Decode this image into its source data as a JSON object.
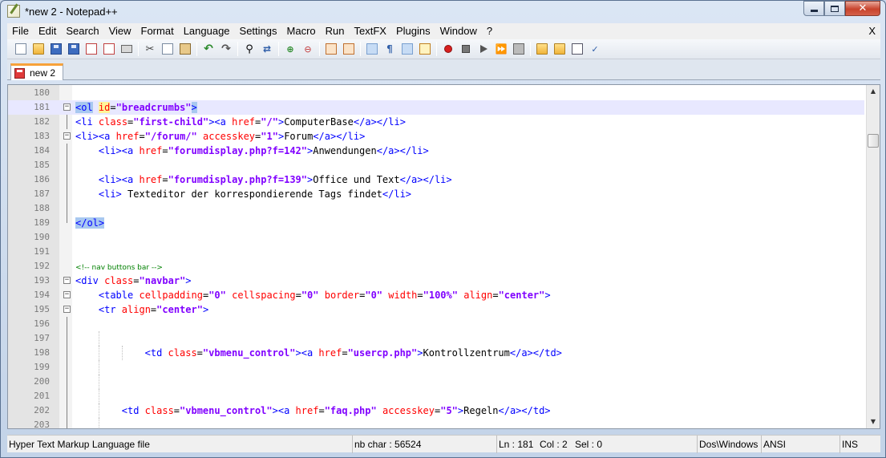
{
  "window": {
    "title": "*new 2 - Notepad++",
    "close_glyph": "✕",
    "minimize_label": "",
    "maximize_label": ""
  },
  "menu": {
    "items": [
      "File",
      "Edit",
      "Search",
      "View",
      "Format",
      "Language",
      "Settings",
      "Macro",
      "Run",
      "TextFX",
      "Plugins",
      "Window",
      "?"
    ],
    "close_doc": "X"
  },
  "toolbar": {
    "icons": [
      "new-file-icon",
      "open-file-icon",
      "save-icon",
      "save-all-icon",
      "close-icon",
      "close-all-icon",
      "print-icon",
      "cut-icon",
      "copy-icon",
      "paste-icon",
      "undo-icon",
      "redo-icon",
      "find-icon",
      "replace-icon",
      "zoom-in-icon",
      "zoom-out-icon",
      "sync-vertical-icon",
      "sync-horizontal-icon",
      "word-wrap-icon",
      "show-all-chars-icon",
      "indent-guide-icon",
      "user-lang-icon",
      "record-macro-icon",
      "stop-macro-icon",
      "play-macro-icon",
      "run-macro-multiple-icon",
      "save-macro-icon",
      "open-folder-icon",
      "explorer-icon",
      "console-icon",
      "spellcheck-icon"
    ]
  },
  "tabs": [
    {
      "label": "new 2",
      "active": true,
      "modified": true
    }
  ],
  "editor": {
    "lines": [
      {
        "n": "180",
        "html": ""
      },
      {
        "n": "181",
        "html": ""
      },
      {
        "n": "182",
        "html": ""
      },
      {
        "n": "183",
        "html": ""
      },
      {
        "n": "184",
        "html": ""
      },
      {
        "n": "185",
        "html": ""
      },
      {
        "n": "186",
        "html": ""
      },
      {
        "n": "187",
        "html": ""
      },
      {
        "n": "188",
        "html": ""
      },
      {
        "n": "189",
        "html": ""
      },
      {
        "n": "190",
        "html": ""
      },
      {
        "n": "191",
        "html": ""
      },
      {
        "n": "192",
        "html": ""
      },
      {
        "n": "193",
        "html": ""
      },
      {
        "n": "194",
        "html": ""
      },
      {
        "n": "195",
        "html": ""
      },
      {
        "n": "196",
        "html": ""
      },
      {
        "n": "197",
        "html": ""
      },
      {
        "n": "198",
        "html": ""
      },
      {
        "n": "199",
        "html": ""
      },
      {
        "n": "200",
        "html": ""
      },
      {
        "n": "201",
        "html": ""
      },
      {
        "n": "202",
        "html": ""
      },
      {
        "n": "203",
        "html": ""
      }
    ]
  },
  "status": {
    "file_type": "Hyper Text Markup Language file",
    "nb_char": "nb char : 56524",
    "ln": "Ln : 181",
    "col": "Col : 2",
    "sel": "Sel : 0",
    "eol": "Dos\\Windows",
    "encoding": "ANSI",
    "mode": "INS"
  }
}
